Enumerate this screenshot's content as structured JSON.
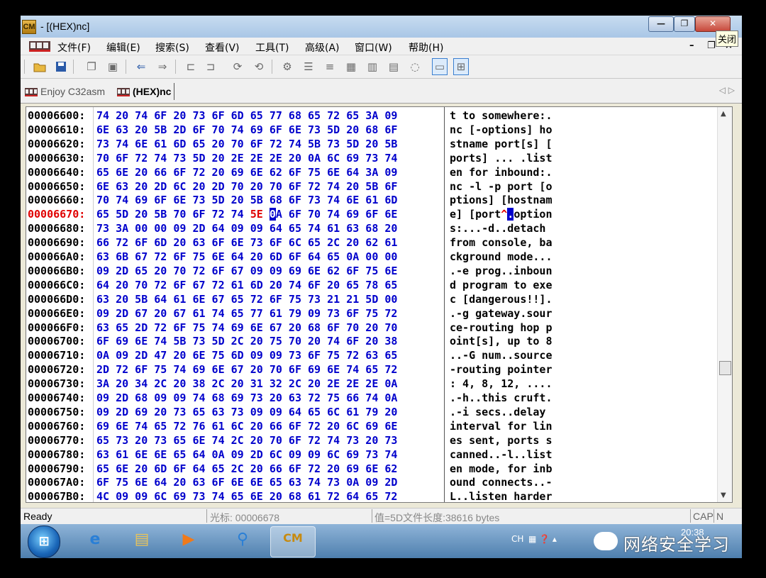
{
  "window": {
    "title": " - [(HEX)nc]",
    "close_tooltip": "关闭",
    "app_icon_label": "CM",
    "minimize_glyph": "—",
    "restore_glyph": "❐",
    "close_glyph": "✕"
  },
  "menu": {
    "items": [
      "文件(F)",
      "编辑(E)",
      "搜索(S)",
      "查看(V)",
      "工具(T)",
      "高级(A)",
      "窗口(W)",
      "帮助(H)"
    ],
    "mdi_minimize": "–",
    "mdi_restore": "❐",
    "mdi_close": "×"
  },
  "toolbar": {
    "icons": [
      "open-folder-icon",
      "save-icon",
      "copy-icon",
      "paste-icon",
      "back-arrow-icon",
      "forward-arrow-icon",
      "tool-1-icon",
      "tool-2-icon",
      "tool-3-icon",
      "tool-4-icon",
      "gear-icon",
      "list-icon",
      "list-2-icon",
      "grid-icon",
      "grid-2-icon",
      "grid-3-icon",
      "refresh-icon",
      "single-pane-icon",
      "split-pane-icon"
    ]
  },
  "tabs": [
    {
      "label": "Enjoy C32asm",
      "active": false
    },
    {
      "label": "(HEX)nc",
      "active": true
    }
  ],
  "tab_arrows": "◁ ▷",
  "hex": {
    "current_address": "00006670",
    "rows": [
      {
        "addr": "00006600:",
        "hex": "74 20 74 6F 20 73 6F 6D 65 77 68 65 72 65 3A 09",
        "ascii": "t to somewhere:."
      },
      {
        "addr": "00006610:",
        "hex": "6E 63 20 5B 2D 6F 70 74 69 6F 6E 73 5D 20 68 6F",
        "ascii": "nc [-options] ho"
      },
      {
        "addr": "00006620:",
        "hex": "73 74 6E 61 6D 65 20 70 6F 72 74 5B 73 5D 20 5B",
        "ascii": "stname port[s] ["
      },
      {
        "addr": "00006630:",
        "hex": "70 6F 72 74 73 5D 20 2E 2E 2E 20 0A 6C 69 73 74",
        "ascii": "ports] ... .list"
      },
      {
        "addr": "00006640:",
        "hex": "65 6E 20 66 6F 72 20 69 6E 62 6F 75 6E 64 3A 09",
        "ascii": "en for inbound:."
      },
      {
        "addr": "00006650:",
        "hex": "6E 63 20 2D 6C 20 2D 70 20 70 6F 72 74 20 5B 6F",
        "ascii": "nc -l -p port [o"
      },
      {
        "addr": "00006660:",
        "hex": "70 74 69 6F 6E 73 5D 20 5B 68 6F 73 74 6E 61 6D",
        "ascii": "ptions] [hostnam"
      },
      {
        "addr": "00006670:",
        "hex_a": "65 5D 20 5B 70 6F 72 74 ",
        "hex_red": "5E",
        "hex_b": " ",
        "hex_cursor": "0",
        "hex_c": "A 6F 70 74 69 6F 6E",
        "ascii_a": "e] [port",
        "ascii_red": "^",
        "ascii_cursor": ".",
        "ascii_b": "option"
      },
      {
        "addr": "00006680:",
        "hex": "73 3A 00 00 09 2D 64 09 09 64 65 74 61 63 68 20",
        "ascii": "s:...-d..detach "
      },
      {
        "addr": "00006690:",
        "hex": "66 72 6F 6D 20 63 6F 6E 73 6F 6C 65 2C 20 62 61",
        "ascii": "from console, ba"
      },
      {
        "addr": "000066A0:",
        "hex": "63 6B 67 72 6F 75 6E 64 20 6D 6F 64 65 0A 00 00",
        "ascii": "ckground mode..."
      },
      {
        "addr": "000066B0:",
        "hex": "09 2D 65 20 70 72 6F 67 09 09 69 6E 62 6F 75 6E",
        "ascii": ".-e prog..inboun"
      },
      {
        "addr": "000066C0:",
        "hex": "64 20 70 72 6F 67 72 61 6D 20 74 6F 20 65 78 65",
        "ascii": "d program to exe"
      },
      {
        "addr": "000066D0:",
        "hex": "63 20 5B 64 61 6E 67 65 72 6F 75 73 21 21 5D 00",
        "ascii": "c [dangerous!!]."
      },
      {
        "addr": "000066E0:",
        "hex": "09 2D 67 20 67 61 74 65 77 61 79 09 73 6F 75 72",
        "ascii": ".-g gateway.sour"
      },
      {
        "addr": "000066F0:",
        "hex": "63 65 2D 72 6F 75 74 69 6E 67 20 68 6F 70 20 70",
        "ascii": "ce-routing hop p"
      },
      {
        "addr": "00006700:",
        "hex": "6F 69 6E 74 5B 73 5D 2C 20 75 70 20 74 6F 20 38",
        "ascii": "oint[s], up to 8"
      },
      {
        "addr": "00006710:",
        "hex": "0A 09 2D 47 20 6E 75 6D 09 09 73 6F 75 72 63 65",
        "ascii": "..-G num..source"
      },
      {
        "addr": "00006720:",
        "hex": "2D 72 6F 75 74 69 6E 67 20 70 6F 69 6E 74 65 72",
        "ascii": "-routing pointer"
      },
      {
        "addr": "00006730:",
        "hex": "3A 20 34 2C 20 38 2C 20 31 32 2C 20 2E 2E 2E 0A",
        "ascii": ": 4, 8, 12, ...."
      },
      {
        "addr": "00006740:",
        "hex": "09 2D 68 09 09 74 68 69 73 20 63 72 75 66 74 0A",
        "ascii": ".-h..this cruft."
      },
      {
        "addr": "00006750:",
        "hex": "09 2D 69 20 73 65 63 73 09 09 64 65 6C 61 79 20",
        "ascii": ".-i secs..delay "
      },
      {
        "addr": "00006760:",
        "hex": "69 6E 74 65 72 76 61 6C 20 66 6F 72 20 6C 69 6E",
        "ascii": "interval for lin"
      },
      {
        "addr": "00006770:",
        "hex": "65 73 20 73 65 6E 74 2C 20 70 6F 72 74 73 20 73",
        "ascii": "es sent, ports s"
      },
      {
        "addr": "00006780:",
        "hex": "63 61 6E 6E 65 64 0A 09 2D 6C 09 09 6C 69 73 74",
        "ascii": "canned..-l..list"
      },
      {
        "addr": "00006790:",
        "hex": "65 6E 20 6D 6F 64 65 2C 20 66 6F 72 20 69 6E 62",
        "ascii": "en mode, for inb"
      },
      {
        "addr": "000067A0:",
        "hex": "6F 75 6E 64 20 63 6F 6E 6E 65 63 74 73 0A 09 2D",
        "ascii": "ound connects..-"
      },
      {
        "addr": "000067B0:",
        "hex": "4C 09 09 6C 69 73 74 65 6E 20 68 61 72 64 65 72",
        "ascii": "L..listen harder"
      }
    ]
  },
  "status": {
    "ready": "Ready",
    "cursor": "光标: 00006678",
    "value_length": "值=5D文件长度:38616 bytes",
    "caps": "CAP",
    "num": "N"
  },
  "taskbar": {
    "start_glyph": "⊞",
    "apps": [
      {
        "name": "ie",
        "glyph": "e",
        "color": "#2a7fd6"
      },
      {
        "name": "explorer",
        "glyph": "▤",
        "color": "#e8c35a"
      },
      {
        "name": "media",
        "glyph": "▶",
        "color": "#f07a1a"
      },
      {
        "name": "search",
        "glyph": "⚲",
        "color": "#2a7fd6"
      },
      {
        "name": "c32asm",
        "glyph": "CM",
        "color": "#c78a10"
      }
    ],
    "tray_lang": "CH",
    "tray_icons": "▦ ❓ ▴",
    "clock": "20:38",
    "watermark": "网络安全学习"
  },
  "colors": {
    "hex_blue": "#0000cc",
    "address_red": "#e00000",
    "cursor_bg": "#0000cc"
  }
}
